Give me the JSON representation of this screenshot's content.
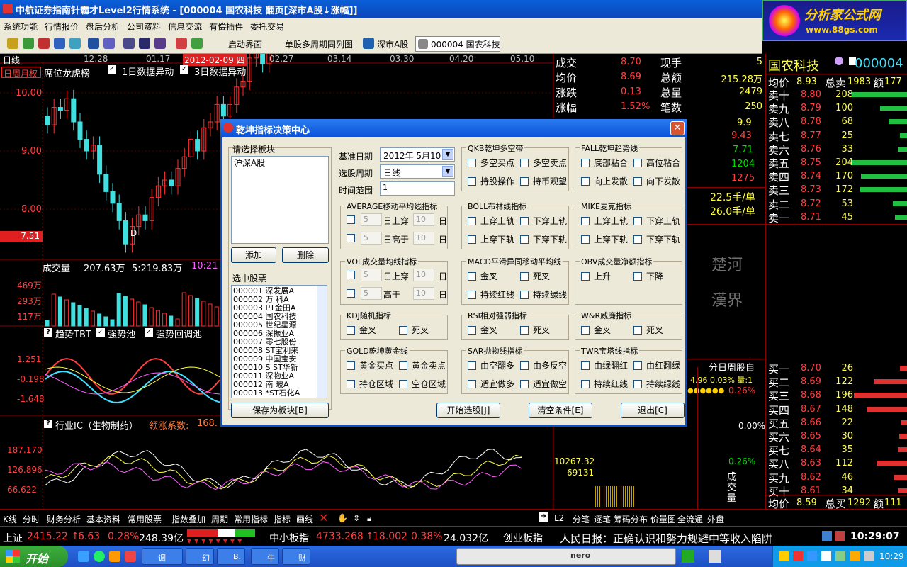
{
  "window": {
    "title": "中航证券指南针霸才Level2行情系统 - [000004  国农科技  翻页[深市A股↓涨幅]]"
  },
  "logo": {
    "line1": "分析家公式网",
    "line2": "www.88gs.com"
  },
  "menu": [
    "系统功能",
    "行情报价",
    "盘后分析",
    "公司资料",
    "信息交流",
    "有偿插件",
    "委托交易"
  ],
  "toolbar": {
    "start_page": "启动界面",
    "multi_period": "单股多周期同列图",
    "market": "深市A股",
    "stock": "000004  国农科技"
  },
  "chart": {
    "period_label": "日线",
    "dates": [
      "12.28",
      "01.17",
      "2012-02-09 四",
      "02.27",
      "03.14",
      "03.30",
      "04.20",
      "05.10"
    ],
    "tabs": "日周月权",
    "tab_extra": "席位龙虎榜",
    "check1": "1日数据异动",
    "check2": "3日数据异动",
    "y_labels": [
      "10.00",
      "9.00",
      "8.00"
    ],
    "current_price": "7.51",
    "d_marker": "D",
    "vol_title": "成交量",
    "vol_value": "207.63万",
    "vol_ma": "5:219.83万",
    "vol_ma10": "10:21",
    "vol_y": [
      "469万",
      "293万",
      "117万"
    ],
    "ind_title": "趋势TBT",
    "ind_check1": "强势池",
    "ind_check2": "强势回调池",
    "ind_y": [
      "1.251",
      "-0.198",
      "-1.648"
    ],
    "ic_title": "行业IC（生物制药）",
    "ic_label": "领涨系数:",
    "ic_value": "168.",
    "ic_y": [
      "187.170",
      "126.896",
      "66.622"
    ]
  },
  "stats": [
    {
      "k": "成交",
      "v": "8.70",
      "k2": "现手",
      "v2": "5"
    },
    {
      "k": "均价",
      "v": "8.69",
      "k2": "总额",
      "v2": "215.28万"
    },
    {
      "k": "涨跌",
      "v": "0.13",
      "k2": "总量",
      "v2": "2479"
    },
    {
      "k": "涨幅",
      "v": "1.52%",
      "k2": "笔数",
      "v2": "250"
    }
  ],
  "right_values": [
    "9.9",
    "9.43",
    "7.71",
    "1204",
    "1275"
  ],
  "right_hand": [
    "22.5手/单",
    "26.0手/单"
  ],
  "chu_he": "楚河",
  "han_jie": "漢界",
  "minute": {
    "tabs": "分日周股自",
    "line1": "4.96  0.03% 量:1",
    "pct": [
      "0.26%",
      "0.00%",
      "0.26%"
    ],
    "amount": "10267.32",
    "vol": "69131",
    "vol_label": "成交量"
  },
  "quote": {
    "name": "国农科技",
    "code": "000004",
    "avg_label": "均价",
    "avg": "8.93",
    "total_sell_label": "总卖",
    "total_sell": "1983",
    "amt_label": "额",
    "amt": "177",
    "sells": [
      {
        "l": "卖十",
        "p": "8.80",
        "v": "208",
        "w": 78
      },
      {
        "l": "卖九",
        "p": "8.79",
        "v": "100",
        "w": 38
      },
      {
        "l": "卖八",
        "p": "8.78",
        "v": "68",
        "w": 26
      },
      {
        "l": "卖七",
        "p": "8.77",
        "v": "25",
        "w": 10
      },
      {
        "l": "卖六",
        "p": "8.76",
        "v": "33",
        "w": 13
      },
      {
        "l": "卖五",
        "p": "8.75",
        "v": "204",
        "w": 78
      },
      {
        "l": "卖四",
        "p": "8.74",
        "v": "170",
        "w": 65
      },
      {
        "l": "卖三",
        "p": "8.73",
        "v": "172",
        "w": 66
      },
      {
        "l": "卖二",
        "p": "8.72",
        "v": "53",
        "w": 20
      },
      {
        "l": "卖一",
        "p": "8.71",
        "v": "45",
        "w": 17
      }
    ],
    "buys": [
      {
        "l": "买一",
        "p": "8.70",
        "v": "26",
        "w": 10
      },
      {
        "l": "买二",
        "p": "8.69",
        "v": "122",
        "w": 47
      },
      {
        "l": "买三",
        "p": "8.68",
        "v": "196",
        "w": 75
      },
      {
        "l": "买四",
        "p": "8.67",
        "v": "148",
        "w": 57
      },
      {
        "l": "买五",
        "p": "8.66",
        "v": "22",
        "w": 8
      },
      {
        "l": "买六",
        "p": "8.65",
        "v": "30",
        "w": 11
      },
      {
        "l": "买七",
        "p": "8.64",
        "v": "35",
        "w": 13
      },
      {
        "l": "买八",
        "p": "8.63",
        "v": "112",
        "w": 43
      },
      {
        "l": "买九",
        "p": "8.62",
        "v": "46",
        "w": 18
      },
      {
        "l": "买十",
        "p": "8.61",
        "v": "34",
        "w": 13
      }
    ],
    "footer": {
      "avg_label": "均价",
      "avg": "8.59",
      "total_buy_label": "总买",
      "total_buy": "1292",
      "amt_label": "额",
      "amt": "111"
    }
  },
  "bottom_tabs": [
    "K线",
    "分时",
    "财务分析",
    "基本资料",
    "常用股票",
    "指数叠加",
    "周期",
    "常用指标",
    "指标",
    "画线"
  ],
  "bottom_right": [
    "L2",
    "分笔",
    "逐笔",
    "筹码分布",
    "价量图",
    "全流通",
    "外盘"
  ],
  "status": {
    "sh_label": "上证",
    "sh_val": "2415.22",
    "sh_chg": "6.63",
    "sh_pct": "0.28%",
    "sh_amt": "248.39亿",
    "zx_label": "中小板指",
    "zx_val": "4733.268",
    "zx_chg": "18.002",
    "zx_pct": "0.38%",
    "zx_amt": "24.032亿",
    "cy_label": "创业板指",
    "news": "人民日报：正确认识和努力规避中等收入陷阱",
    "time": "10:29:07"
  },
  "taskbar": {
    "start": "开始",
    "tasks": [
      "调",
      "幻",
      "B.",
      "牛",
      "财"
    ],
    "clock": "10:29",
    "nero": "nero"
  },
  "dialog": {
    "title": "乾坤指标决策中心",
    "sector_label": "请选择板块",
    "sector_value": "沪深A股",
    "add": "添加",
    "delete": "删除",
    "selected_label": "选中股票",
    "stocks": [
      "000001 深发展A",
      "000002 万  科A",
      "000003 PT金田A",
      "000004 国农科技",
      "000005 世纪星源",
      "000006 深振业A",
      "000007 零七股份",
      "000008 ST宝利来",
      "000009 中国宝安",
      "000010 S ST华新",
      "000011 深物业A",
      "000012 南  玻A",
      "000013 *ST石化A"
    ],
    "save": "保存为板块[B]",
    "base_date_label": "基准日期",
    "base_date": "2012年 5月10日",
    "period_label": "选股周期",
    "period": "日线",
    "range_label": "时间范围",
    "range": "1",
    "groups": {
      "qkb": {
        "title": "QKB乾坤多空带",
        "items": [
          "多空买点",
          "多空卖点",
          "持股操作",
          "持币观望"
        ]
      },
      "fall": {
        "title": "FALL乾坤趋势线",
        "items": [
          "底部粘合",
          "高位粘合",
          "向上发散",
          "向下发散"
        ]
      },
      "avg": {
        "title": "AVERAGE移动平均线指标",
        "a1": "5",
        "a2": "10",
        "l1": "日上穿",
        "l2": "日高于",
        "u": "日"
      },
      "boll": {
        "title": "BOLL布林线指标",
        "items": [
          "上穿上轨",
          "下穿上轨",
          "上穿下轨",
          "下穿下轨"
        ]
      },
      "mike": {
        "title": "MIKE麦克指标",
        "items": [
          "上穿上轨",
          "下穿上轨",
          "上穿下轨",
          "下穿下轨"
        ]
      },
      "vol": {
        "title": "VOL成交量均线指标",
        "a1": "5",
        "a2": "10",
        "l1": "日上穿",
        "l2": "高于",
        "u": "日"
      },
      "macd": {
        "title": "MACD平滑异同移动平均线",
        "items": [
          "金叉",
          "死叉",
          "持续红线",
          "持续绿线"
        ]
      },
      "obv": {
        "title": "OBV成交量净额指标",
        "items": [
          "上升",
          "下降"
        ]
      },
      "kdj": {
        "title": "KDJ随机指标",
        "items": [
          "金叉",
          "死叉"
        ]
      },
      "rsi": {
        "title": "RSI相对强弱指标",
        "items": [
          "金叉",
          "死叉"
        ]
      },
      "wr": {
        "title": "W&R威廉指标",
        "items": [
          "金叉",
          "死叉"
        ]
      },
      "gold": {
        "title": "GOLD乾坤黄金线",
        "items": [
          "黄金买点",
          "黄金卖点",
          "持仓区域",
          "空仓区域"
        ]
      },
      "sar": {
        "title": "SAR抛物线指标",
        "items": [
          "由空翻多",
          "由多反空",
          "适宜做多",
          "适宜做空"
        ]
      },
      "twr": {
        "title": "TWR宝塔线指标",
        "items": [
          "由绿翻红",
          "由红翻绿",
          "持续红线",
          "持续绿线"
        ]
      }
    },
    "start_btn": "开始选股[J]",
    "clear_btn": "清空条件[E]",
    "exit_btn": "退出[C]"
  }
}
